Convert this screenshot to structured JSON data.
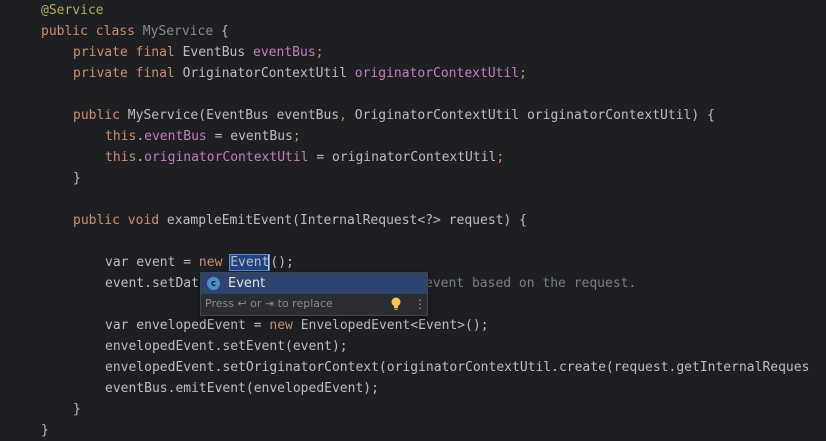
{
  "code": {
    "l1": {
      "annotation": "@Service"
    },
    "l2": {
      "kw": "public class ",
      "name": "MyService",
      "rest": " {"
    },
    "l3": {
      "kw": "private final ",
      "type": "EventBus ",
      "var": "eventBus",
      "end": ";"
    },
    "l4": {
      "kw": "private final ",
      "type": "OriginatorContextUtil ",
      "var": "originatorContextUtil",
      "end": ";"
    },
    "l6": {
      "kw": "public ",
      "name": "MyService",
      "p1": "(EventBus eventBus",
      "comma": ", ",
      "p2": "OriginatorContextUtil originatorContextUtil) {"
    },
    "l7": {
      "kw": "this",
      "dot": ".",
      "field": "eventBus",
      "rest": " = eventBus",
      "end": ";"
    },
    "l8": {
      "kw": "this",
      "dot": ".",
      "field": "originatorContextUtil",
      "rest": " = originatorContextUtil",
      "end": ";"
    },
    "l9": {
      "text": "}"
    },
    "l11": {
      "kw": "public void ",
      "name": "exampleEmitEvent",
      "rest": "(InternalRequest<?> request) {"
    },
    "l13": {
      "pre": "var event = ",
      "kw": "new ",
      "hl": "Event",
      "rest": "();"
    },
    "l14": {
      "pre": "event.setDat",
      "tail": "event based on the request."
    },
    "l16": {
      "pre": "var envelopedEvent = ",
      "kw": "new ",
      "rest": "EnvelopedEvent<Event>();"
    },
    "l17": {
      "text": "envelopedEvent.setEvent(event);"
    },
    "l18": {
      "text": "envelopedEvent.setOriginatorContext(originatorContextUtil.create(request.getInternalReques"
    },
    "l19": {
      "text": "eventBus.emitEvent(envelopedEvent);"
    },
    "l20": {
      "text": "}"
    },
    "l21": {
      "text": "}"
    }
  },
  "completion": {
    "item_icon_letter": "c",
    "item_label": "Event",
    "hint": "Press ↩ or ⇥ to replace",
    "bulb_icon": "lightbulb-icon",
    "more_icon": "more-vertical-icon"
  },
  "colors": {
    "background": "#1e1f22",
    "keyword": "#cf8e6d",
    "annotation": "#b3ae60",
    "field": "#c77dbb",
    "selection": "#214283"
  }
}
